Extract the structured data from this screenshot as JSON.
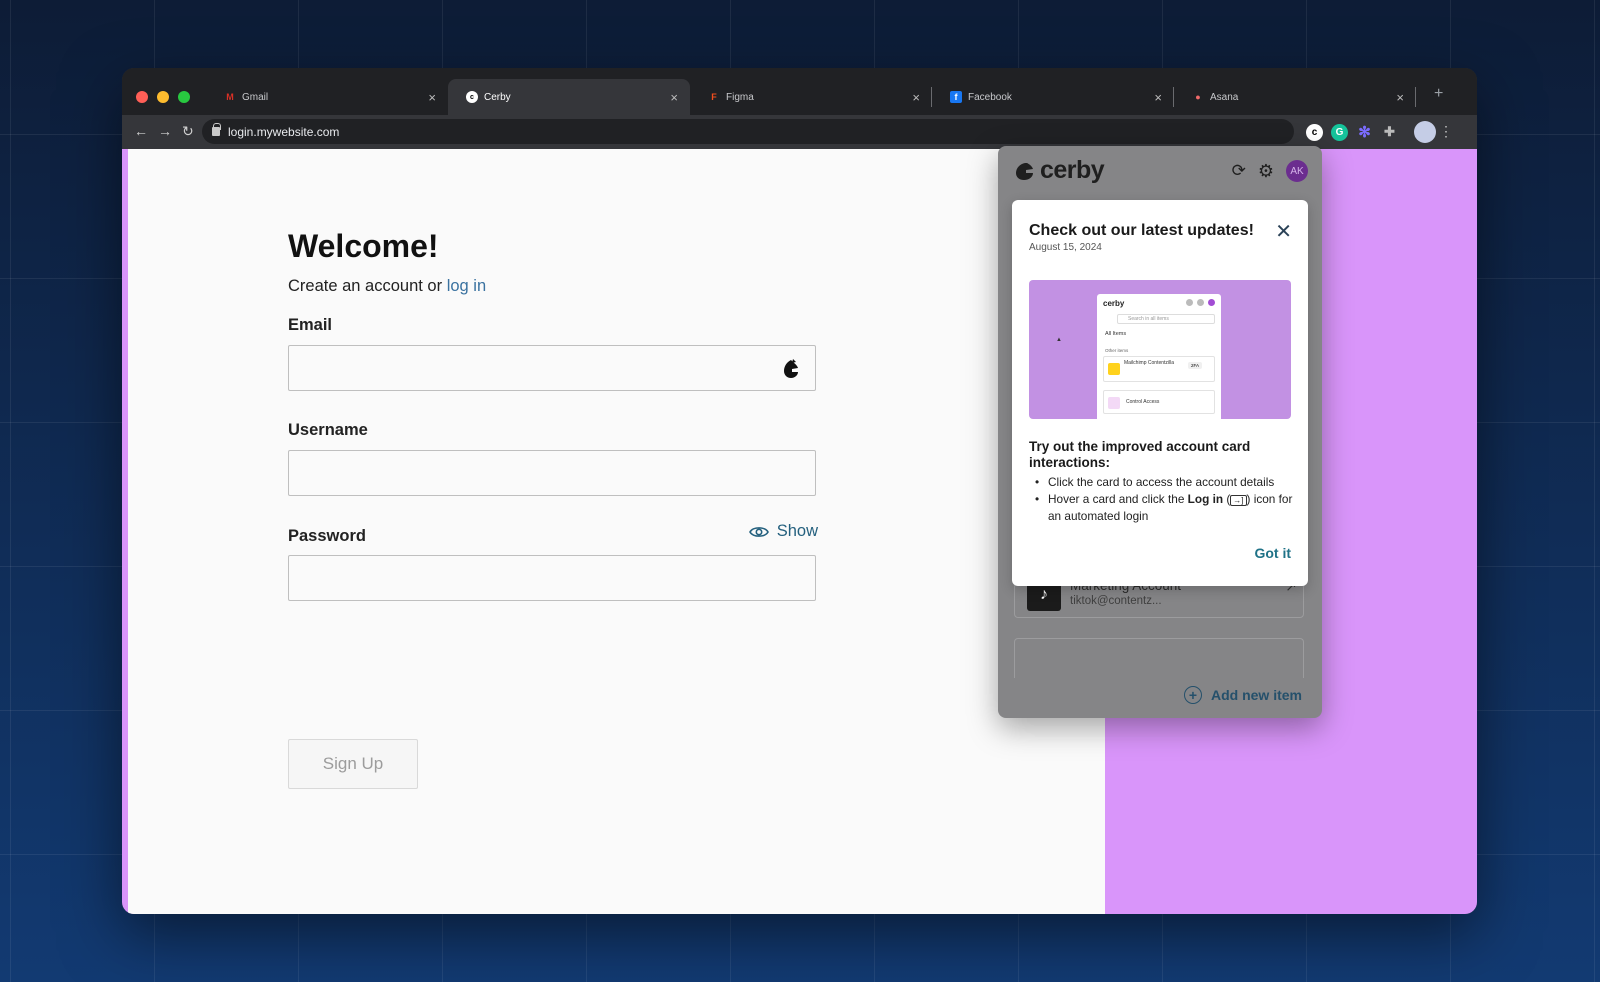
{
  "browser": {
    "tabs": [
      {
        "label": "Gmail",
        "icon": "gmail-icon",
        "color": "#d93025"
      },
      {
        "label": "Cerby",
        "icon": "cerby-icon",
        "color": "#ffffff"
      },
      {
        "label": "Figma",
        "icon": "figma-icon",
        "color": "#f24e1e"
      },
      {
        "label": "Facebook",
        "icon": "facebook-icon",
        "color": "#1877f2"
      },
      {
        "label": "Asana",
        "icon": "asana-icon",
        "color": "#f06a6a"
      }
    ],
    "active_tab": 1,
    "url": "login.mywebsite.com",
    "new_tab": "+",
    "close_glyph": "×"
  },
  "form": {
    "title": "Welcome!",
    "subtitle_prefix": "Create an account or ",
    "subtitle_link": "log in",
    "email_label": "Email",
    "username_label": "Username",
    "password_label": "Password",
    "show_label": "Show",
    "signup_label": "Sign Up"
  },
  "extension": {
    "brand": "cerby",
    "avatar_initials": "AK",
    "account_name": "Marketing Account",
    "account_sub": "tiktok@contentz...",
    "add_item_label": "Add new item"
  },
  "popup": {
    "title": "Check out our latest updates!",
    "date": "August 15, 2024",
    "heading": "Try out the improved account card interactions:",
    "bullet1": "Click the card to access the account details",
    "bullet2_prefix": "Hover a card and click the ",
    "bullet2_bold": "Log in",
    "bullet2_suffix": " icon for an automated login",
    "got_it": "Got it",
    "preview": {
      "brand": "cerby",
      "search": "Search in all items",
      "all_items": "All Items",
      "other_items": "Other items",
      "card1": "Mailchimp Contentzilla",
      "badge": "2FA",
      "card2": "Control Access"
    }
  },
  "colors": {
    "page_bg": "#d995fa",
    "link": "#3a72a0",
    "accent": "#1f7287"
  }
}
